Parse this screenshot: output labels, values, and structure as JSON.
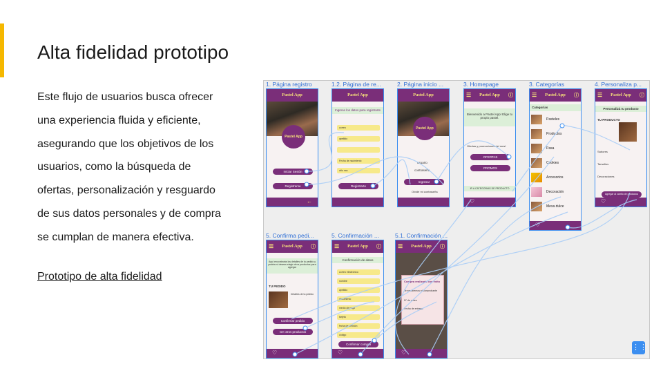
{
  "slide": {
    "title": "Alta fidelidad prototipo",
    "body_lines": [
      "Este flujo de usuarios busca ofrecer",
      "una experiencia fluida y eficiente,",
      "asegurando que los objetivos de los",
      "usuarios, como la búsqueda de",
      "ofertas, personalización y resguardo",
      "de sus datos personales y de compra",
      "se cumplan de manera efectiva."
    ],
    "link_text": "Prototipo de alta fidelidad",
    "accent_color": "#f5b800"
  },
  "prototype": {
    "app_name": "Pastel App",
    "brand_color": "#7a2e79",
    "link_color": "#3b8ef0",
    "screens": [
      {
        "title": "1. Página registro",
        "buttons": [
          "Iniciar Sesión",
          "Registrarse"
        ]
      },
      {
        "title": "1.2. Página de re...",
        "heading": "Ingrese los datos para registrarte",
        "fields": [
          "correo",
          "apellido",
          "",
          "Fecha de nacimiento",
          "año nac"
        ],
        "button": "Registrarte"
      },
      {
        "title": "2. Página inicio ...",
        "fields": [
          "usuario",
          "contraseña"
        ],
        "button": "Ingresar",
        "forgot": "Olvidé mi contraseña"
      },
      {
        "title": "3. Homepage",
        "welcome": "Bienvenido a Pastel App! Elige tu propio pastel.",
        "offers": "Ofertas y promociones del mes!",
        "buttons": [
          "OFERTAS",
          "PROMOS"
        ],
        "categories_link": "IR A CATEGORIAS DE PRODUCTO"
      },
      {
        "title": "3. Categorías",
        "heading": "Categorías",
        "items": [
          "Pasteles",
          "Productos",
          "Pasa",
          "Cookies",
          "Accesorios",
          "Decoración",
          "Mesa dulce"
        ]
      },
      {
        "title": "4. Personaliza p...",
        "heading": "Personalizá tu producto",
        "label": "TU PRODUCTO",
        "options": [
          "Sabores",
          "Tamaños",
          "Decoraciones"
        ],
        "button": "Agregar al carrito de productos"
      },
      {
        "title": "5. Confirma pedi...",
        "banner": "Aquí encontrarás los detalles de tu pedido y podrás si deseas elegir otros productos para agregar",
        "label": "TU PEDIDO",
        "detail": "Detalles de tu pedido",
        "buttons": [
          "Confirmar pedido",
          "ver otros productos"
        ]
      },
      {
        "title": "5. Confirmación ...",
        "heading": "Confirmación de datos",
        "fields": [
          "correo electrónico",
          "nombre",
          "apellido",
          "documento",
          "medio de pago",
          "tarjeta",
          "fecha de emisión",
          "código"
        ],
        "button": "Confirmar compra"
      },
      {
        "title": "5.1. Confirmación ...",
        "dialog": "Compra realizada con éxito",
        "lines": [
          "Te envíaremos el comprobante",
          "N° de orden",
          "Fecha de entrega"
        ]
      }
    ]
  }
}
